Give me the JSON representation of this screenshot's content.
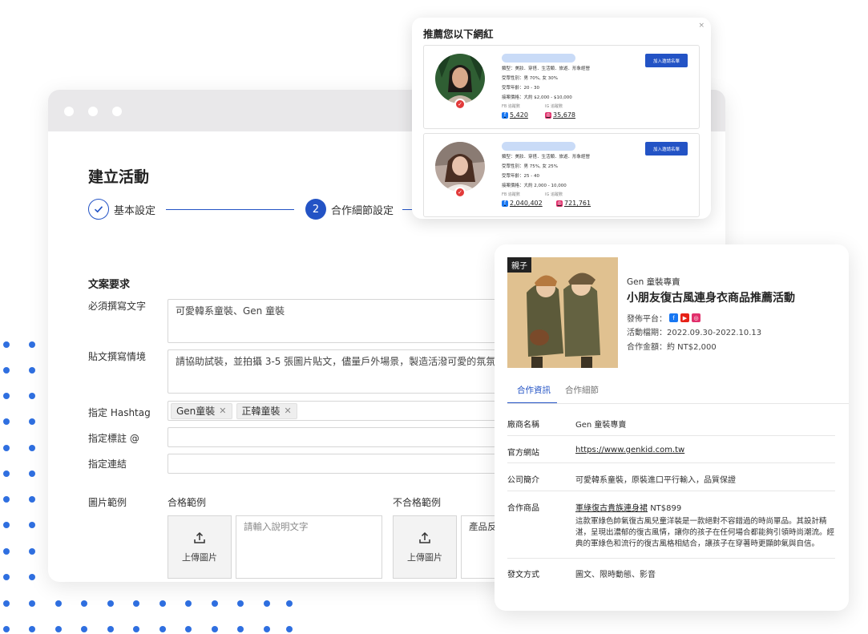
{
  "form": {
    "title": "建立活動",
    "steps": [
      {
        "number": "✓",
        "label": "基本設定"
      },
      {
        "number": "2",
        "label": "合作細節設定"
      }
    ],
    "section_title": "文案要求",
    "required_text_label": "必須撰寫文字",
    "required_text_value": "可愛韓系童裝、Gen 童裝",
    "post_context_label": "貼文撰寫情境",
    "post_context_value": "請協助試裝，並拍攝 3-5 張圖片貼文，儘量戶外場景，製造活潑可愛的氛氛。",
    "hashtag_label": "指定 Hashtag",
    "hashtags": [
      "Gen童裝",
      "正韓童裝"
    ],
    "mention_label": "指定標註 @",
    "link_label": "指定連結",
    "image_label": "圖片範例",
    "good_example_label": "合格範例",
    "bad_example_label": "不合格範例",
    "upload_label": "上傳圖片",
    "desc_placeholder": "請輸入說明文字",
    "bad_desc_value": "產品反"
  },
  "recommend": {
    "title": "推薦您以下網紅",
    "close": "×",
    "invite_label": "加入邀請名單",
    "fb_label": "FB 追蹤數",
    "ig_label": "IG 追蹤數",
    "influencers": [
      {
        "type": "類型：美妝．穿搭．生活類．旅遊．形象經營",
        "gender": "受眾性別：男 70%, 女 30%",
        "age": "受眾年齡：20 - 30",
        "price": "接案價格：大約 $2,000 - $10,000",
        "fb": "5,420",
        "ig": "35,678"
      },
      {
        "type": "類型：美妝．穿搭．生活類．旅遊．形象經營",
        "gender": "受眾性別：男 75%, 女 25%",
        "age": "受眾年齡：25 - 40",
        "price": "接案價格：大約 2,000 - 10,000",
        "fb": "2,040,402",
        "ig": "721,761"
      }
    ]
  },
  "campaign": {
    "tag": "親子",
    "brand": "Gen 童裝專賣",
    "title": "小朋友復古風連身衣商品推薦活動",
    "platform_label": "發佈平台：",
    "period": "活動檔期：2022.09.30-2022.10.13",
    "amount": "合作金額：約 NT$2,000",
    "tabs": [
      "合作資訊",
      "合作細節"
    ],
    "rows": {
      "brand_k": "廠商名稱",
      "brand_v": "Gen 童裝專賣",
      "site_k": "官方網站",
      "site_v": "https://www.genkid.com.tw",
      "intro_k": "公司簡介",
      "intro_v": "可愛韓系童裝，原裝進口平行輸入，品質保證",
      "product_k": "合作商品",
      "product_name": "軍綠復古貴族連身裙",
      "product_price": "NT$899",
      "product_desc": "這款軍綠色帥氣復古風兒童洋裝是一款絕對不容錯過的時尚單品。其設計精湛，呈現出濃郁的復古風情，讓你的孩子在任何場合都能夠引領時尚潮流。經典的軍綠色和流行的復古風格相結合，讓孩子在穿著時更顯帥氣與自信。",
      "format_k": "發文方式",
      "format_v": "圖文、限時動態、影音"
    }
  },
  "colors": {
    "accent": "#2353c5",
    "dots": "#2f6fe0"
  }
}
